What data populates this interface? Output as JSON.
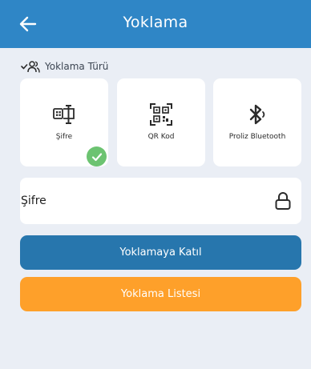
{
  "header": {
    "title": "Yoklama",
    "bg_color": "#2f86c6"
  },
  "section": {
    "label": "Yoklama Türü"
  },
  "cards": [
    {
      "label": "Şifre",
      "icon": "password-keypad-icon",
      "selected": true
    },
    {
      "label": "QR Kod",
      "icon": "qr-code-icon",
      "selected": false
    },
    {
      "label": "Proliz Bluetooth",
      "icon": "bluetooth-icon",
      "selected": false
    }
  ],
  "password_field": {
    "label": "Şifre",
    "value": "",
    "icon": "lock-icon"
  },
  "buttons": {
    "join_label": "Yoklamaya Katıl",
    "join_color": "#2776ad",
    "list_label": "Yoklama Listesi",
    "list_color": "#fea02a"
  },
  "colors": {
    "background": "#eaeef5",
    "selected_check": "#6cc371"
  }
}
